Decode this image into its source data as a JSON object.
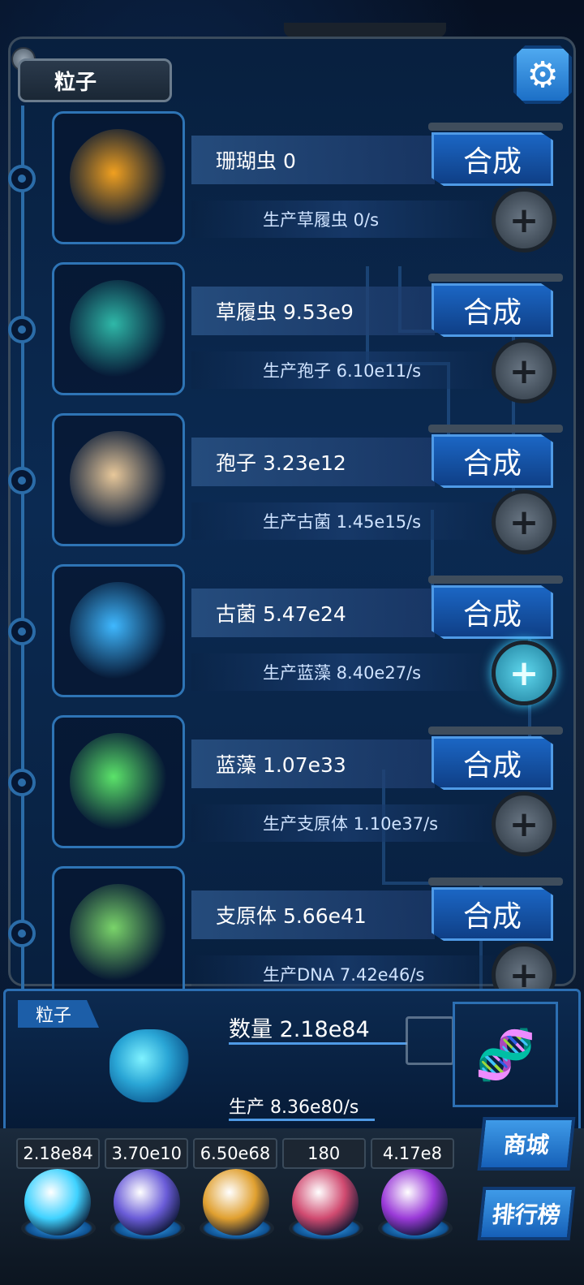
{
  "header": {
    "title": "粒子",
    "settings_icon": "gear-icon"
  },
  "items": [
    {
      "name": "珊瑚虫 0",
      "synth_label": "合成",
      "production": "生产草履虫 0/s",
      "plus_active": false,
      "color": "#f0a020"
    },
    {
      "name": "草履虫 9.53e9",
      "synth_label": "合成",
      "production": "生产孢子 6.10e11/s",
      "plus_active": false,
      "color": "#2fb8a8"
    },
    {
      "name": "孢子 3.23e12",
      "synth_label": "合成",
      "production": "生产古菌 1.45e15/s",
      "plus_active": false,
      "color": "#e8c89a"
    },
    {
      "name": "古菌 5.47e24",
      "synth_label": "合成",
      "production": "生产蓝藻 8.40e27/s",
      "plus_active": true,
      "color": "#3fb8ff"
    },
    {
      "name": "蓝藻 1.07e33",
      "synth_label": "合成",
      "production": "生产支原体 1.10e37/s",
      "plus_active": false,
      "color": "#5be36a"
    },
    {
      "name": "支原体 5.66e41",
      "synth_label": "合成",
      "production": "生产DNA 7.42e46/s",
      "plus_active": false,
      "color": "#7ad46a"
    }
  ],
  "summary": {
    "tag": "粒子",
    "count": "数量 2.18e84",
    "production": "生产 8.36e80/s"
  },
  "resources": [
    "2.18e84",
    "3.70e10",
    "6.50e68",
    "180",
    "4.17e8"
  ],
  "side_buttons": {
    "shop": "商城",
    "rank": "排行榜"
  },
  "orbs": [
    {
      "name": "particle-orb",
      "color": "#3fd2ff"
    },
    {
      "name": "lightning-orb",
      "color": "#6a5cd8"
    },
    {
      "name": "galaxy-orb",
      "color": "#e0a030"
    },
    {
      "name": "brain-orb",
      "color": "#d04a70"
    },
    {
      "name": "vortex-orb",
      "color": "#9a3ad8"
    }
  ]
}
